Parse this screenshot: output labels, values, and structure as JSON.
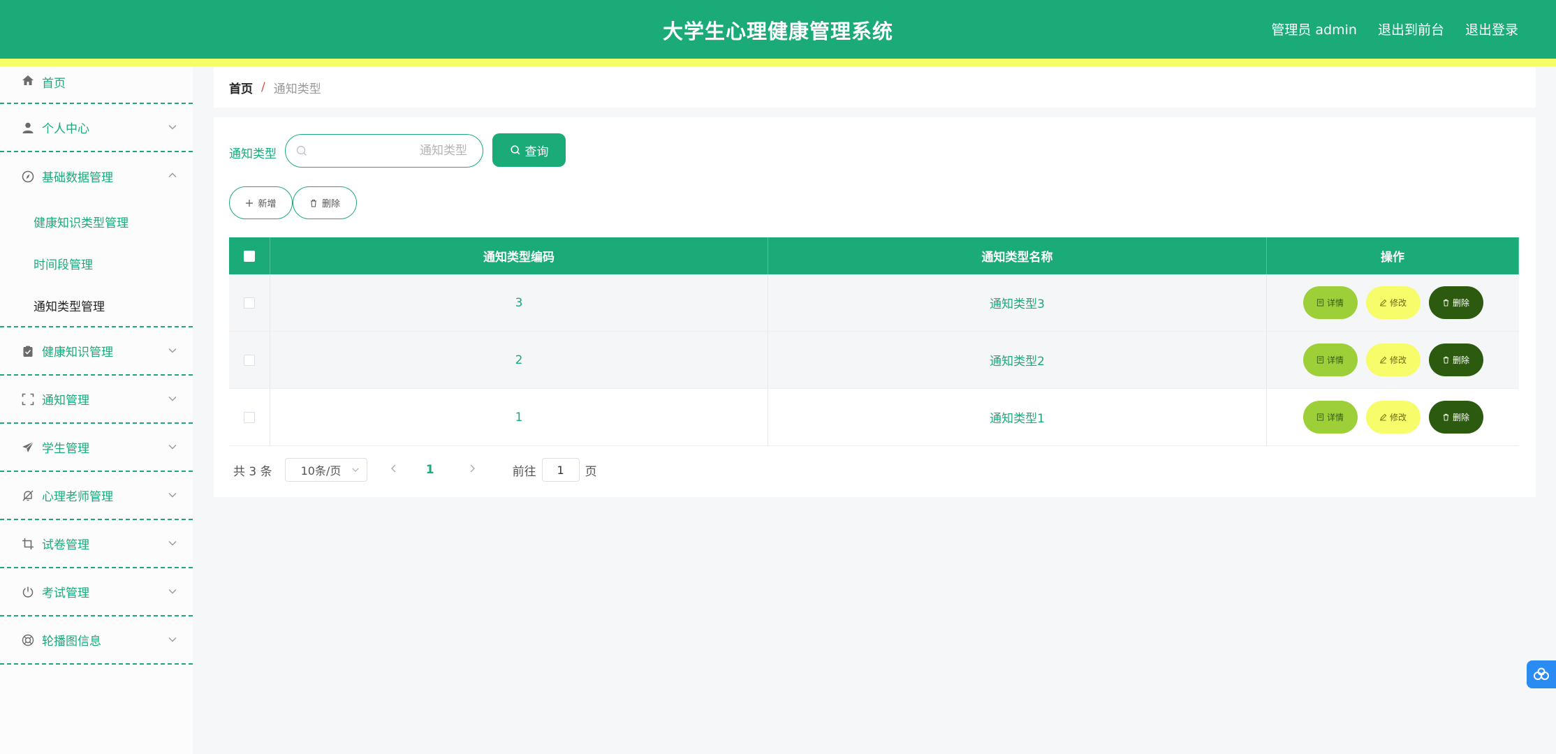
{
  "header": {
    "title": "大学生心理健康管理系统",
    "user_label": "管理员 admin",
    "front_link": "退出到前台",
    "logout_link": "退出登录"
  },
  "sidebar": {
    "home": "首页",
    "personal": "个人中心",
    "basic_data": "基础数据管理",
    "basic_sub": [
      "健康知识类型管理",
      "时间段管理",
      "通知类型管理"
    ],
    "knowledge": "健康知识管理",
    "notice": "通知管理",
    "student": "学生管理",
    "teacher": "心理老师管理",
    "paper": "试卷管理",
    "exam": "考试管理",
    "carousel": "轮播图信息"
  },
  "breadcrumb": {
    "home": "首页",
    "separator": "/",
    "current": "通知类型"
  },
  "search": {
    "label": "通知类型",
    "placeholder": "通知类型",
    "button": "查询"
  },
  "actions": {
    "add": "新增",
    "delete": "删除"
  },
  "table": {
    "headers": [
      "通知类型编码",
      "通知类型名称",
      "操作"
    ],
    "rows": [
      {
        "code": "3",
        "name": "通知类型3"
      },
      {
        "code": "2",
        "name": "通知类型2"
      },
      {
        "code": "1",
        "name": "通知类型1"
      }
    ],
    "row_buttons": {
      "detail": "详情",
      "edit": "修改",
      "delete": "删除"
    }
  },
  "pagination": {
    "total": "共 3 条",
    "page_size": "10条/页",
    "current_page": "1",
    "goto_label": "前往",
    "goto_value": "1",
    "page_suffix": "页"
  },
  "colors": {
    "primary": "#1aab79",
    "stripe": "#f5ff66",
    "detail_btn": "#9ccf38",
    "edit_btn": "#f7fc6a",
    "delete_btn": "#2c5a0e"
  }
}
